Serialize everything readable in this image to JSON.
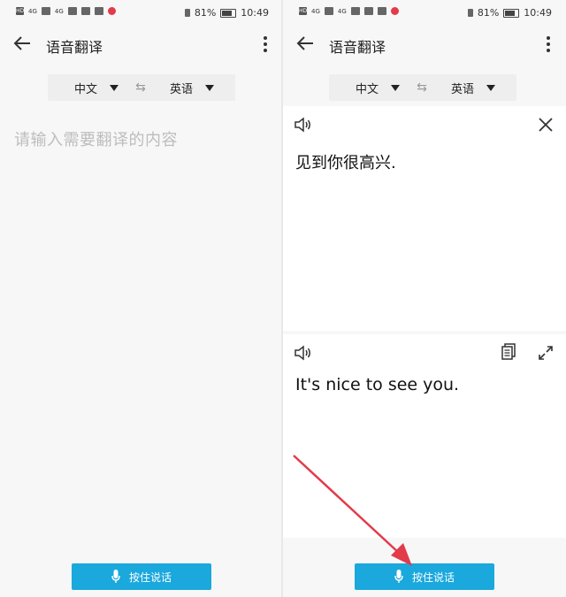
{
  "status_bar": {
    "battery": "81%",
    "time": "10:49",
    "signal_1": "4G",
    "signal_2": "4G"
  },
  "app": {
    "title": "语音翻译"
  },
  "language": {
    "source": "中文",
    "target": "英语",
    "swap_glyph": "⇆"
  },
  "left_screen": {
    "input_placeholder": "请输入需要翻译的内容",
    "talk_button_label": "按住说话"
  },
  "right_screen": {
    "source_text": "见到你很高兴.",
    "translated_text": "It's nice to see you.",
    "talk_button_label": "按住说话"
  },
  "colors": {
    "accent": "#1aa8dd",
    "annotation_arrow": "#e23b4a",
    "placeholder": "#bdbdbd"
  },
  "icons": [
    "back-arrow-icon",
    "more-vert-icon",
    "caret-down-icon",
    "swap-icon",
    "speaker-icon",
    "close-icon",
    "copy-icon",
    "expand-icon",
    "mic-icon"
  ]
}
